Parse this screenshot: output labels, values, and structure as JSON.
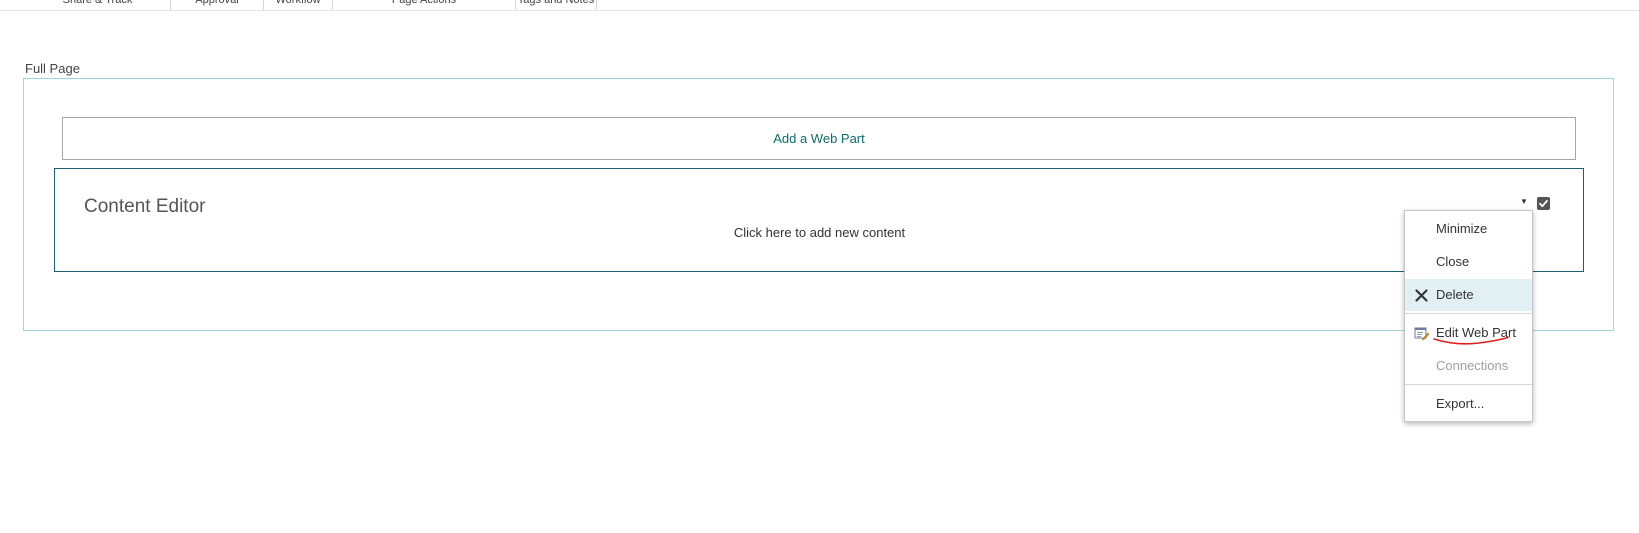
{
  "ribbon": {
    "groups": [
      {
        "label": "Share & Track"
      },
      {
        "label": "Approval"
      },
      {
        "label": "Workflow"
      },
      {
        "label": "Page Actions"
      },
      {
        "label": "Tags and Notes"
      }
    ]
  },
  "zone": {
    "title": "Full Page",
    "add_webpart_label": "Add a Web Part"
  },
  "webpart": {
    "title": "Content Editor",
    "content_text": "Click here to add new content",
    "dropdown_icon": "dropdown-arrow-icon",
    "checkbox_checked": true
  },
  "menu": {
    "items": [
      {
        "label": "Minimize",
        "icon": "",
        "state": "normal"
      },
      {
        "label": "Close",
        "icon": "",
        "state": "normal"
      },
      {
        "label": "Delete",
        "icon": "delete-x-icon",
        "state": "hover"
      },
      {
        "label": "Edit Web Part",
        "icon": "edit-webpart-icon",
        "state": "normal"
      },
      {
        "label": "Connections",
        "icon": "",
        "state": "disabled"
      },
      {
        "label": "Export...",
        "icon": "",
        "state": "normal"
      }
    ]
  },
  "colors": {
    "zone_border": "#9fd4e0",
    "webpart_border": "#1b6170",
    "link": "#0f6b6b",
    "menu_hover": "#e1f0f2",
    "annotation": "#e02020"
  }
}
